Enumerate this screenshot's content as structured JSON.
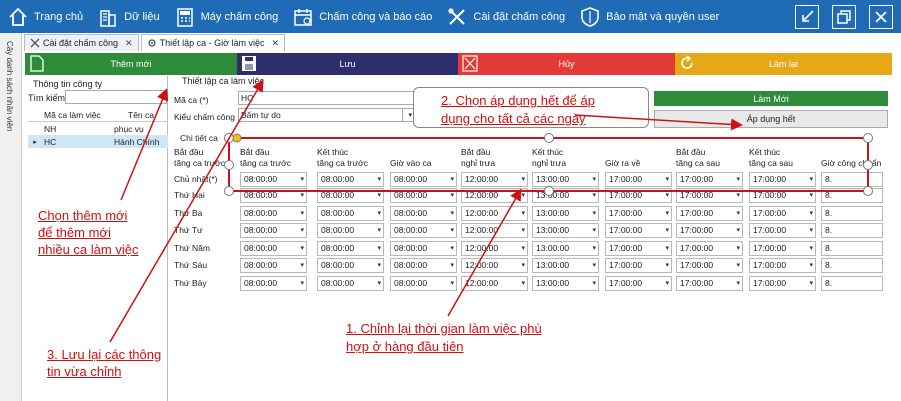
{
  "menu": {
    "items": [
      {
        "label": "Trang chủ",
        "icon": "home-icon"
      },
      {
        "label": "Dữ liệu",
        "icon": "building-icon"
      },
      {
        "label": "Máy chấm công",
        "icon": "calculator-icon"
      },
      {
        "label": "Chấm công và báo cáo",
        "icon": "calendar-icon"
      },
      {
        "label": "Cài đặt chấm công",
        "icon": "tools-icon"
      },
      {
        "label": "Bảo mật và quyền user",
        "icon": "shield-icon"
      }
    ]
  },
  "side_strip": {
    "label": "Cây danh sách nhân viên"
  },
  "tabs": [
    {
      "label": "Cài đặt chấm công"
    },
    {
      "label": "Thiết lập ca - Giờ làm việc"
    }
  ],
  "toolbar": {
    "add_label": "Thêm mới",
    "save_label": "Lưu",
    "cancel_label": "Hủy",
    "reset_label": "Làm lại"
  },
  "company": {
    "title": "Thông tin công ty",
    "search_label": "Tìm kiếm",
    "columns": [
      "Mã ca làm việc",
      "Tên ca"
    ],
    "rows": [
      {
        "code": "NH",
        "name": "phục vụ",
        "selected": false
      },
      {
        "code": "HC",
        "name": "Hành Chính",
        "selected": true
      }
    ]
  },
  "setup": {
    "title": "Thiết lập ca làm việc",
    "shift_code_label": "Mã ca (*)",
    "shift_code_value": "HC",
    "mode_label": "Kiểu chấm công",
    "mode_value": "Bấm tự do",
    "new_label": "Làm Mới",
    "apply_all_label": "Áp dụng hết"
  },
  "detail": {
    "title": "Chi tiết ca",
    "row_header": [
      "Bắt đầu",
      "tăng ca trước"
    ],
    "columns": [
      [
        "Bắt đầu",
        "tăng ca trước"
      ],
      [
        "Kết thúc",
        "tăng ca trước"
      ],
      [
        "",
        "Giờ vào ca"
      ],
      [
        "Bắt đầu",
        "nghỉ trưa"
      ],
      [
        "Kết thúc",
        "nghỉ trưa"
      ],
      [
        "",
        "Giờ ra về"
      ],
      [
        "Bắt đầu",
        "tăng ca sau"
      ],
      [
        "Kết thúc",
        "tăng ca sau"
      ],
      [
        "",
        "Giờ công chuẩn"
      ]
    ],
    "days": [
      "Chủ nhật(*)",
      "Thứ Hai",
      "Thứ Ba",
      "Thứ Tư",
      "Thứ Năm",
      "Thứ Sáu",
      "Thứ Bảy"
    ],
    "times": [
      "08:00:00",
      "08:00:00",
      "08:00:00",
      "12:00:00",
      "13:00:00",
      "17:00:00",
      "17:00:00",
      "17:00:00"
    ],
    "standard_hours": "8."
  },
  "annotations": {
    "step1": [
      "1. Chỉnh lại thời gian làm việc phù",
      "hợp ở hàng đầu tiên"
    ],
    "step2": [
      "2. Chọn áp dụng hết để áp",
      "dụng cho tất cả các ngày"
    ],
    "step3": [
      "3. Lưu lại các thông",
      "tin vừa chỉnh"
    ],
    "add_more": [
      "Chọn thêm mới",
      "để thêm mới",
      "nhiều ca làm việc"
    ]
  },
  "colors": {
    "menubar": "#1f6bb5",
    "add": "#2e8b3a",
    "save": "#2f2d6e",
    "cancel": "#e53935",
    "reset": "#e6a817",
    "annotation": "#d01010"
  }
}
